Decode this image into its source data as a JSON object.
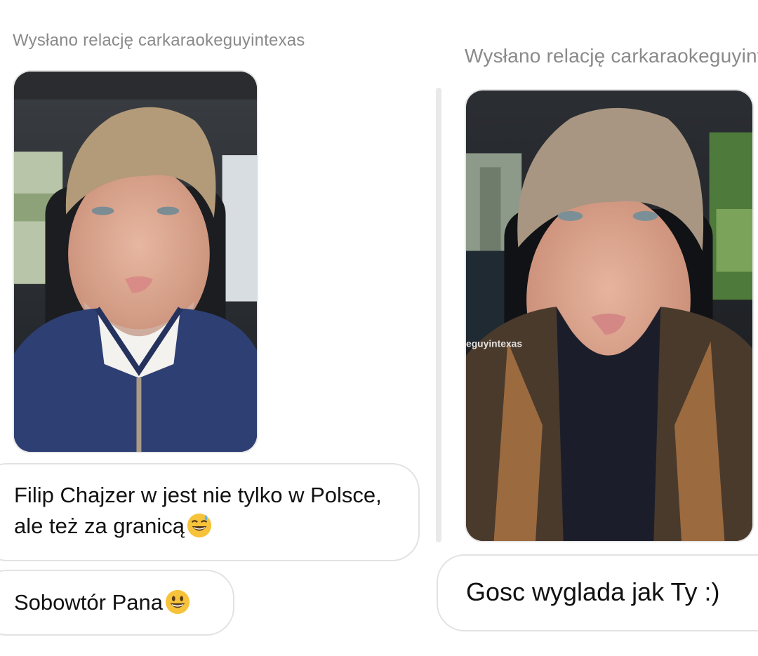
{
  "left": {
    "story_label": "Wysłano relację carkaraokeguyintexas",
    "messages": [
      {
        "lines": [
          "Filip Chajzer w jest nie tylko w Polsce,",
          "ale też za granicą"
        ],
        "emoji": "grinning-sweat-emoji"
      },
      {
        "lines": [
          "Sobowtór Pana"
        ],
        "emoji": "grinning-face-emoji"
      }
    ]
  },
  "right": {
    "story_label": "Wysłano relację carkaraokeguyintexas",
    "watermark": "eguyintexas",
    "messages": [
      {
        "lines": [
          "Gosc wyglada jak Ty :)"
        ]
      }
    ]
  },
  "colors": {
    "label_gray": "#8a8a8a",
    "bubble_border": "#e2e2e2",
    "jacket_blue": "#2e3f73",
    "jacket_brown": "#4a3a2c"
  }
}
